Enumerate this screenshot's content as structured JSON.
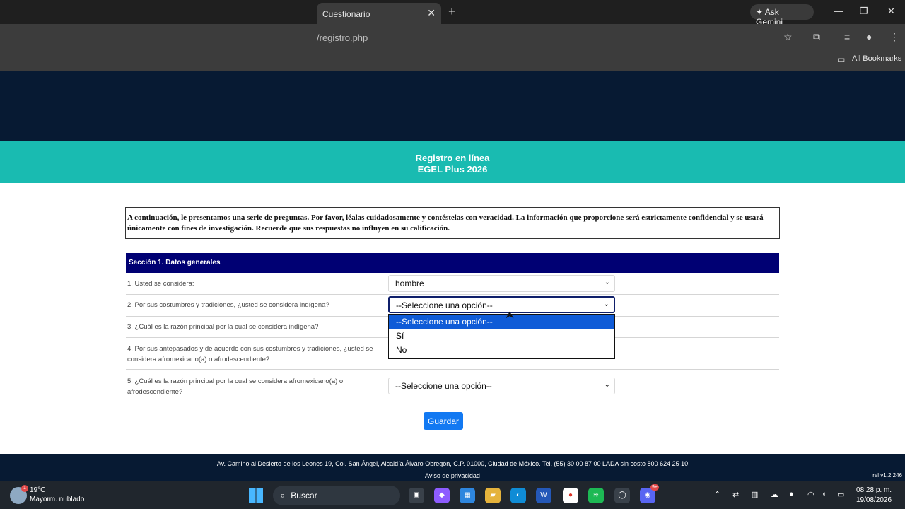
{
  "browser": {
    "tab_title": "Cuestionario",
    "tab_close": "✕",
    "new_tab": "+",
    "ask_gemini": "Ask Gemini",
    "url": "/registro.php",
    "all_bookmarks": "All Bookmarks",
    "window_controls": [
      "—",
      "❐",
      "✕"
    ]
  },
  "hero": {
    "line1": "Registro en línea",
    "line2": "EGEL Plus 2026",
    "dark_color": "#071a33",
    "teal_color": "#19bbb1"
  },
  "form": {
    "intro": "A continuación, le presentamos una serie de preguntas. Por favor, léalas cuidadosamente y contéstelas con veracidad. La información que proporcione será estrictamente confidencial y se usará únicamente con fines de investigación. Recuerde que sus respuestas no influyen en su calificación.",
    "section_title": "Sección 1. Datos generales",
    "questions": [
      {
        "text": "1. Usted se considera:",
        "value": "hombre"
      },
      {
        "text": "2. Por sus costumbres y tradiciones, ¿usted se considera indígena?",
        "value": "--Seleccione una opción--"
      },
      {
        "text": "3. ¿Cuál es la razón principal por la cual se considera indígena?",
        "value": ""
      },
      {
        "text": "4. Por sus antepasados y de acuerdo con sus costumbres y tradiciones, ¿usted se considera afromexicano(a) o afrodescendiente?",
        "value": ""
      },
      {
        "text": "5. ¿Cuál es la razón principal por la cual se considera afromexicano(a) o afrodescendiente?",
        "value": "--Seleccione una opción--"
      }
    ],
    "dropdown_options": [
      "--Seleccione una opción--",
      "Sí",
      "No"
    ],
    "save_label": "Guardar",
    "section_color": "#000073",
    "button_color": "#1279f2"
  },
  "footer": {
    "address": "Av. Camino al Desierto de los Leones 19, Col. San Ángel, Alcaldía Álvaro Obregón, C.P. 01000, Ciudad de México. Tel. (55) 30 00 87 00 LADA sin costo 800 624 25 10",
    "privacy": "Aviso de privacidad",
    "version": "rel v1.2.246"
  },
  "taskbar": {
    "weather_badge": "1",
    "temperature": "19°C",
    "weather": "Mayorm. nublado",
    "search_placeholder": "Buscar",
    "time": "08:28 p. m.",
    "date": "19/08/2026",
    "discord_badge": "9+",
    "word_label": "W"
  },
  "icons": {
    "search": "search-icon",
    "caret": "chevron-down-icon",
    "star": "star-icon",
    "extension": "puzzle-icon",
    "bookmark": "folder-icon"
  }
}
